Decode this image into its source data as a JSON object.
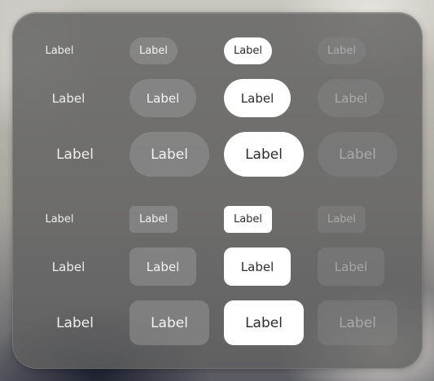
{
  "capsule_rows": [
    {
      "plain": "Label",
      "tinted": "Label",
      "filled": "Label",
      "disabled": "Label"
    },
    {
      "plain": "Label",
      "tinted": "Label",
      "filled": "Label",
      "disabled": "Label"
    },
    {
      "plain": "Label",
      "tinted": "Label",
      "filled": "Label",
      "disabled": "Label"
    }
  ],
  "rounded_rows": [
    {
      "plain": "Label",
      "tinted": "Label",
      "filled": "Label",
      "disabled": "Label"
    },
    {
      "plain": "Label",
      "tinted": "Label",
      "filled": "Label",
      "disabled": "Label"
    },
    {
      "plain": "Label",
      "tinted": "Label",
      "filled": "Label",
      "disabled": "Label"
    }
  ],
  "colors": {
    "panel": "#606060",
    "filled_bg": "#ffffff",
    "filled_text": "#2c2c2c",
    "plain_text": "#eeeeee"
  }
}
